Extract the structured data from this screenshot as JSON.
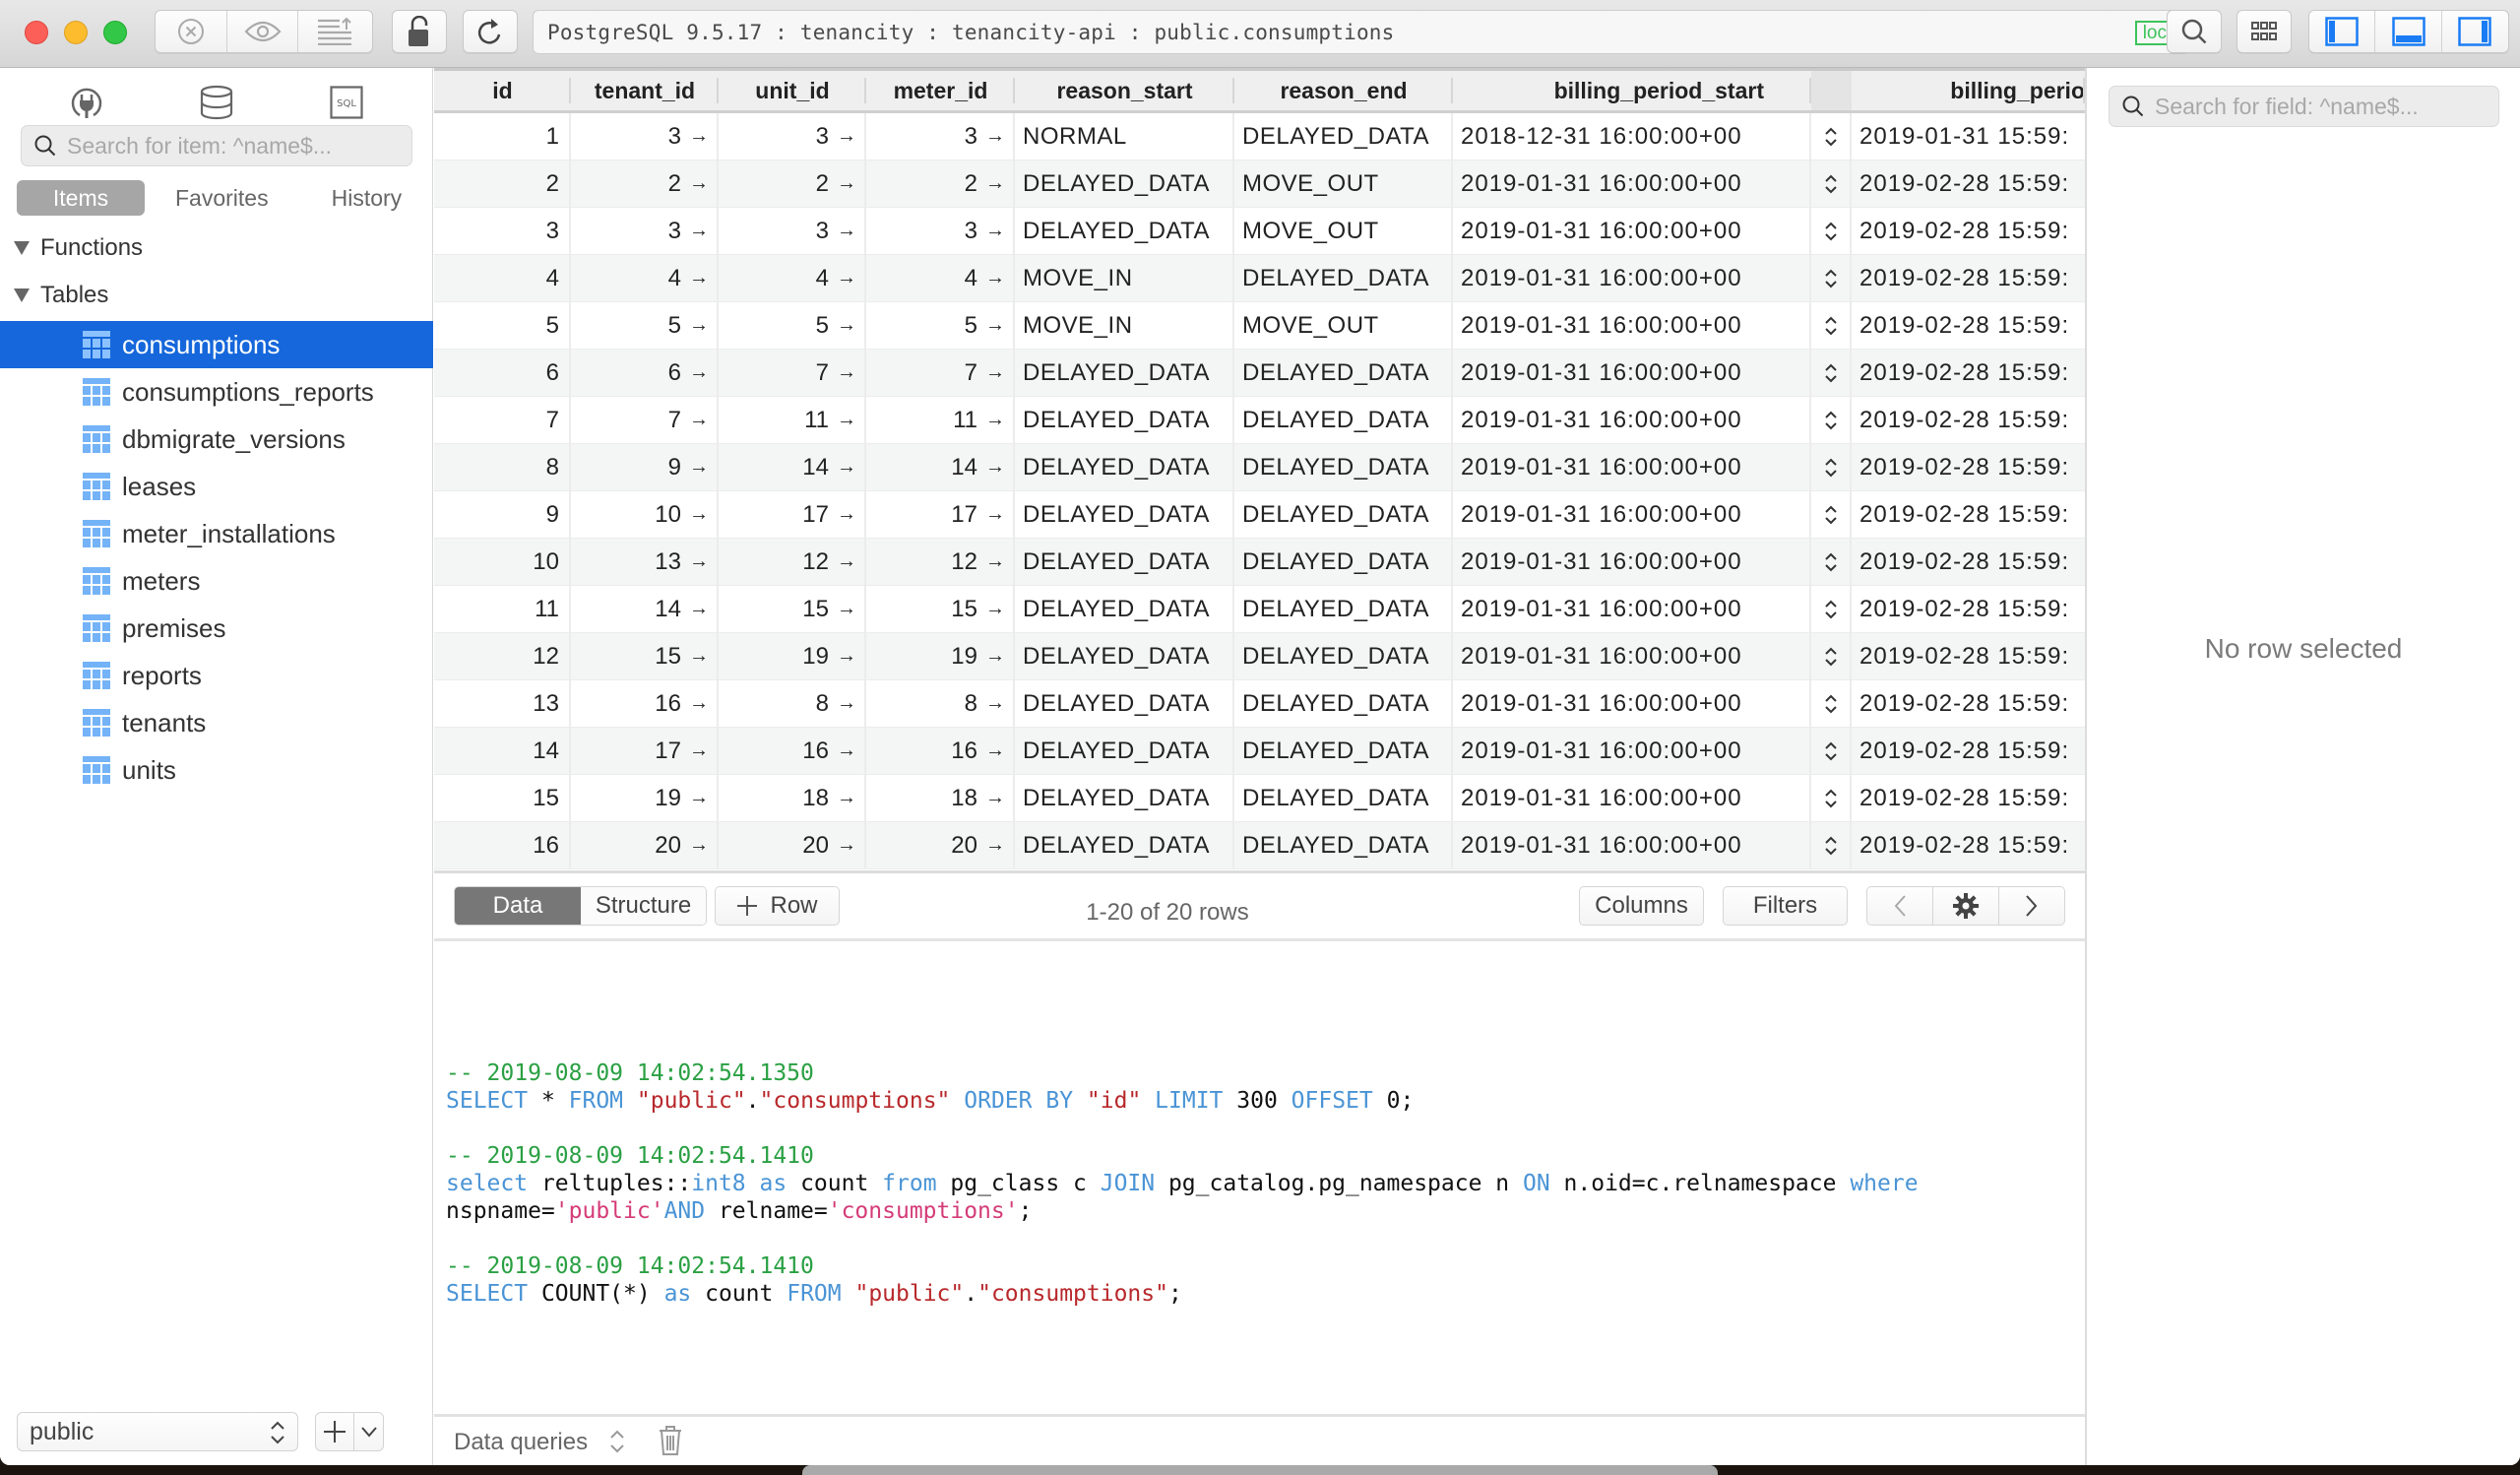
{
  "window": {
    "url_text": "PostgreSQL 9.5.17 : tenancity : tenancity-api : public.consumptions",
    "connection_badge": "loc",
    "toolbar_icons": [
      "close-circle-icon",
      "eye-icon",
      "import-icon",
      "lock-open-icon",
      "reload-icon",
      "search-icon",
      "grid-icon",
      "toggle-left-panel-icon",
      "toggle-bottom-panel-icon",
      "toggle-right-panel-icon"
    ]
  },
  "sidebar": {
    "top_icons": [
      "plug-icon",
      "database-icon",
      "sql-icon"
    ],
    "sql_icon_label": "SQL",
    "search_placeholder": "Search for item: ^name$...",
    "tabs": [
      {
        "label": "Items",
        "active": true
      },
      {
        "label": "Favorites",
        "active": false
      },
      {
        "label": "History",
        "active": false
      }
    ],
    "sections": [
      {
        "label": "Functions",
        "expanded": true
      },
      {
        "label": "Tables",
        "expanded": true
      }
    ],
    "tables": [
      {
        "label": "consumptions",
        "selected": true
      },
      {
        "label": "consumptions_reports",
        "selected": false
      },
      {
        "label": "dbmigrate_versions",
        "selected": false
      },
      {
        "label": "leases",
        "selected": false
      },
      {
        "label": "meter_installations",
        "selected": false
      },
      {
        "label": "meters",
        "selected": false
      },
      {
        "label": "premises",
        "selected": false
      },
      {
        "label": "reports",
        "selected": false
      },
      {
        "label": "tenants",
        "selected": false
      },
      {
        "label": "units",
        "selected": false
      }
    ],
    "schema": "public"
  },
  "grid": {
    "columns": [
      "id",
      "tenant_id",
      "unit_id",
      "meter_id",
      "reason_start",
      "reason_end",
      "billing_period_start",
      "",
      "billing_perio"
    ],
    "fk_arrow": "→",
    "sort_glyph": "⌃⌄",
    "rows": [
      {
        "id": "1",
        "tenant_id": "3",
        "unit_id": "3",
        "meter_id": "3",
        "reason_start": "NORMAL",
        "reason_end": "DELAYED_DATA",
        "billing_period_start": "2018-12-31 16:00:00+00",
        "billing_period_end": "2019-01-31 15:59:"
      },
      {
        "id": "2",
        "tenant_id": "2",
        "unit_id": "2",
        "meter_id": "2",
        "reason_start": "DELAYED_DATA",
        "reason_end": "MOVE_OUT",
        "billing_period_start": "2019-01-31 16:00:00+00",
        "billing_period_end": "2019-02-28 15:59:"
      },
      {
        "id": "3",
        "tenant_id": "3",
        "unit_id": "3",
        "meter_id": "3",
        "reason_start": "DELAYED_DATA",
        "reason_end": "MOVE_OUT",
        "billing_period_start": "2019-01-31 16:00:00+00",
        "billing_period_end": "2019-02-28 15:59:"
      },
      {
        "id": "4",
        "tenant_id": "4",
        "unit_id": "4",
        "meter_id": "4",
        "reason_start": "MOVE_IN",
        "reason_end": "DELAYED_DATA",
        "billing_period_start": "2019-01-31 16:00:00+00",
        "billing_period_end": "2019-02-28 15:59:"
      },
      {
        "id": "5",
        "tenant_id": "5",
        "unit_id": "5",
        "meter_id": "5",
        "reason_start": "MOVE_IN",
        "reason_end": "MOVE_OUT",
        "billing_period_start": "2019-01-31 16:00:00+00",
        "billing_period_end": "2019-02-28 15:59:"
      },
      {
        "id": "6",
        "tenant_id": "6",
        "unit_id": "7",
        "meter_id": "7",
        "reason_start": "DELAYED_DATA",
        "reason_end": "DELAYED_DATA",
        "billing_period_start": "2019-01-31 16:00:00+00",
        "billing_period_end": "2019-02-28 15:59:"
      },
      {
        "id": "7",
        "tenant_id": "7",
        "unit_id": "11",
        "meter_id": "11",
        "reason_start": "DELAYED_DATA",
        "reason_end": "DELAYED_DATA",
        "billing_period_start": "2019-01-31 16:00:00+00",
        "billing_period_end": "2019-02-28 15:59:"
      },
      {
        "id": "8",
        "tenant_id": "9",
        "unit_id": "14",
        "meter_id": "14",
        "reason_start": "DELAYED_DATA",
        "reason_end": "DELAYED_DATA",
        "billing_period_start": "2019-01-31 16:00:00+00",
        "billing_period_end": "2019-02-28 15:59:"
      },
      {
        "id": "9",
        "tenant_id": "10",
        "unit_id": "17",
        "meter_id": "17",
        "reason_start": "DELAYED_DATA",
        "reason_end": "DELAYED_DATA",
        "billing_period_start": "2019-01-31 16:00:00+00",
        "billing_period_end": "2019-02-28 15:59:"
      },
      {
        "id": "10",
        "tenant_id": "13",
        "unit_id": "12",
        "meter_id": "12",
        "reason_start": "DELAYED_DATA",
        "reason_end": "DELAYED_DATA",
        "billing_period_start": "2019-01-31 16:00:00+00",
        "billing_period_end": "2019-02-28 15:59:"
      },
      {
        "id": "11",
        "tenant_id": "14",
        "unit_id": "15",
        "meter_id": "15",
        "reason_start": "DELAYED_DATA",
        "reason_end": "DELAYED_DATA",
        "billing_period_start": "2019-01-31 16:00:00+00",
        "billing_period_end": "2019-02-28 15:59:"
      },
      {
        "id": "12",
        "tenant_id": "15",
        "unit_id": "19",
        "meter_id": "19",
        "reason_start": "DELAYED_DATA",
        "reason_end": "DELAYED_DATA",
        "billing_period_start": "2019-01-31 16:00:00+00",
        "billing_period_end": "2019-02-28 15:59:"
      },
      {
        "id": "13",
        "tenant_id": "16",
        "unit_id": "8",
        "meter_id": "8",
        "reason_start": "DELAYED_DATA",
        "reason_end": "DELAYED_DATA",
        "billing_period_start": "2019-01-31 16:00:00+00",
        "billing_period_end": "2019-02-28 15:59:"
      },
      {
        "id": "14",
        "tenant_id": "17",
        "unit_id": "16",
        "meter_id": "16",
        "reason_start": "DELAYED_DATA",
        "reason_end": "DELAYED_DATA",
        "billing_period_start": "2019-01-31 16:00:00+00",
        "billing_period_end": "2019-02-28 15:59:"
      },
      {
        "id": "15",
        "tenant_id": "19",
        "unit_id": "18",
        "meter_id": "18",
        "reason_start": "DELAYED_DATA",
        "reason_end": "DELAYED_DATA",
        "billing_period_start": "2019-01-31 16:00:00+00",
        "billing_period_end": "2019-02-28 15:59:"
      },
      {
        "id": "16",
        "tenant_id": "20",
        "unit_id": "20",
        "meter_id": "20",
        "reason_start": "DELAYED_DATA",
        "reason_end": "DELAYED_DATA",
        "billing_period_start": "2019-01-31 16:00:00+00",
        "billing_period_end": "2019-02-28 15:59:"
      }
    ]
  },
  "gridbar": {
    "tabs": [
      {
        "label": "Data",
        "active": true
      },
      {
        "label": "Structure",
        "active": false
      }
    ],
    "add_row_label": "Row",
    "row_count": "1-20 of 20 rows",
    "columns_label": "Columns",
    "filters_label": "Filters"
  },
  "sqllog": {
    "entries": [
      {
        "comment": "-- 2019-08-09 14:02:54.1350",
        "tokens": [
          [
            "kw",
            "SELECT"
          ],
          [
            "pl",
            " * "
          ],
          [
            "kw",
            "FROM"
          ],
          [
            "pl",
            " "
          ],
          [
            "str",
            "\"public\""
          ],
          [
            "pl",
            "."
          ],
          [
            "str",
            "\"consumptions\""
          ],
          [
            "pl",
            " "
          ],
          [
            "kw",
            "ORDER BY"
          ],
          [
            "pl",
            " "
          ],
          [
            "str",
            "\"id\""
          ],
          [
            "pl",
            " "
          ],
          [
            "kw",
            "LIMIT"
          ],
          [
            "pl",
            " 300 "
          ],
          [
            "kw",
            "OFFSET"
          ],
          [
            "pl",
            " 0;"
          ]
        ]
      },
      {
        "comment": "-- 2019-08-09 14:02:54.1410",
        "tokens": [
          [
            "kw",
            "select"
          ],
          [
            "pl",
            " reltuples::"
          ],
          [
            "kw",
            "int8"
          ],
          [
            "pl",
            " "
          ],
          [
            "kw",
            "as"
          ],
          [
            "pl",
            " count "
          ],
          [
            "kw",
            "from"
          ],
          [
            "pl",
            " pg_class c "
          ],
          [
            "kw",
            "JOIN"
          ],
          [
            "pl",
            " pg_catalog.pg_namespace n "
          ],
          [
            "kw",
            "ON"
          ],
          [
            "pl",
            " n.oid=c.relnamespace "
          ],
          [
            "kw",
            "where"
          ],
          [
            "br",
            ""
          ],
          [
            "pl",
            "nspname="
          ],
          [
            "sq",
            "'public'"
          ],
          [
            "kw",
            "AND"
          ],
          [
            "pl",
            " relname="
          ],
          [
            "sq",
            "'consumptions'"
          ],
          [
            "pl",
            ";"
          ]
        ]
      },
      {
        "comment": "-- 2019-08-09 14:02:54.1410",
        "tokens": [
          [
            "kw",
            "SELECT"
          ],
          [
            "pl",
            " COUNT(*) "
          ],
          [
            "kw",
            "as"
          ],
          [
            "pl",
            " count "
          ],
          [
            "kw",
            "FROM"
          ],
          [
            "pl",
            " "
          ],
          [
            "str",
            "\"public\""
          ],
          [
            "pl",
            "."
          ],
          [
            "str",
            "\"consumptions\""
          ],
          [
            "pl",
            ";"
          ]
        ]
      }
    ],
    "filter_label": "Data queries"
  },
  "rightpanel": {
    "search_placeholder": "Search for field: ^name$...",
    "empty_text": "No row selected"
  },
  "colors": {
    "accent": "#1567db",
    "table_icon": "#74b3f7",
    "sql_comment": "#2aa043",
    "sql_keyword": "#4a94d6",
    "sql_identifier": "#b8282b",
    "sql_string": "#d43c78",
    "badge": "#3ec35b"
  }
}
